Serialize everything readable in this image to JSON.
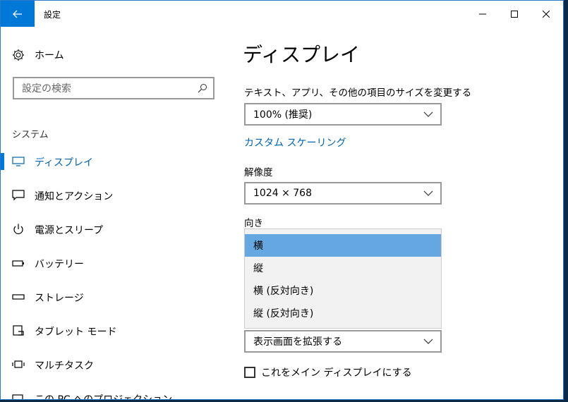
{
  "window": {
    "title": "設定"
  },
  "sidebar": {
    "home_label": "ホーム",
    "search_placeholder": "設定の検索",
    "section_label": "システム",
    "items": [
      {
        "label": "ディスプレイ",
        "icon": "monitor-icon",
        "active": true
      },
      {
        "label": "通知とアクション",
        "icon": "notification-icon"
      },
      {
        "label": "電源とスリープ",
        "icon": "power-icon"
      },
      {
        "label": "バッテリー",
        "icon": "battery-icon"
      },
      {
        "label": "ストレージ",
        "icon": "storage-icon"
      },
      {
        "label": "タブレット モード",
        "icon": "tablet-icon"
      },
      {
        "label": "マルチタスク",
        "icon": "multitask-icon"
      },
      {
        "label": "この PC へのプロジェクション",
        "icon": "projection-icon"
      }
    ]
  },
  "main": {
    "title": "ディスプレイ",
    "scale_label": "テキスト、アプリ、その他の項目のサイズを変更する",
    "scale_value": "100% (推奨)",
    "custom_scaling_link": "カスタム スケーリング",
    "resolution_label": "解像度",
    "resolution_value": "1024 × 768",
    "orientation_label": "向き",
    "orientation_options": [
      "横",
      "縦",
      "横 (反対向き)",
      "縦 (反対向き)"
    ],
    "orientation_selected": "横",
    "multi_display_value": "表示画面を拡張する",
    "main_display_checkbox": "これをメイン ディスプレイにする"
  },
  "colors": {
    "accent": "#0078d7",
    "link": "#0063b1",
    "selected_item": "#65a7e0"
  }
}
